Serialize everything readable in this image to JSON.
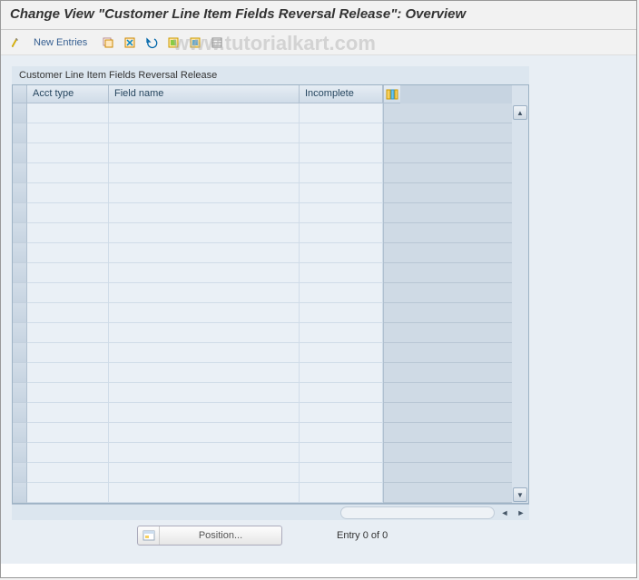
{
  "title": "Change View \"Customer Line Item Fields Reversal Release\": Overview",
  "toolbar": {
    "new_entries": "New Entries"
  },
  "watermark": "www.tutorialkart.com",
  "panel": {
    "title": "Customer Line Item Fields Reversal Release",
    "columns": {
      "c1": "Acct type",
      "c2": "Field name",
      "c3": "Incomplete"
    },
    "row_count": 20
  },
  "footer": {
    "position_label": "Position...",
    "entry_text": "Entry 0 of 0"
  }
}
